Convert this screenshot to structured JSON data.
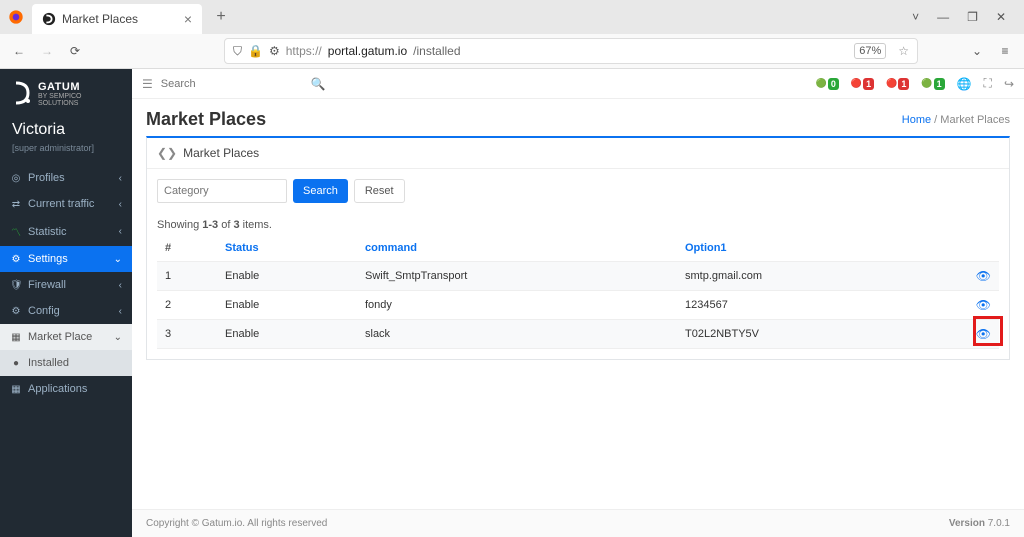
{
  "browser": {
    "tab_title": "Market Places",
    "url_proto": "https://",
    "url_domain": "portal.gatum.io",
    "url_path": "/installed",
    "zoom": "67%"
  },
  "brand": {
    "name": "GATUM",
    "sub": "BY SEMPICO SOLUTIONS"
  },
  "user": {
    "name": "Victoria",
    "role": "[super administrator]"
  },
  "nav": {
    "profiles": "Profiles",
    "current_traffic": "Current traffic",
    "statistic": "Statistic",
    "settings": "Settings",
    "firewall": "Firewall",
    "config": "Config",
    "market_place": "Market Place",
    "installed": "Installed",
    "applications": "Applications"
  },
  "topbar": {
    "search_placeholder": "Search"
  },
  "top_badges": [
    "0",
    "1",
    "1",
    "1"
  ],
  "page": {
    "title": "Market Places",
    "breadcrumb_home": "Home",
    "breadcrumb_current": "Market Places"
  },
  "panel": {
    "title": "Market Places",
    "category_placeholder": "Category",
    "search": "Search",
    "reset": "Reset"
  },
  "table": {
    "summary_prefix": "Showing ",
    "summary_range": "1-3",
    "summary_of": " of ",
    "summary_total": "3",
    "summary_suffix": " items.",
    "col_num": "#",
    "col_status": "Status",
    "col_command": "command",
    "col_option1": "Option1",
    "rows": [
      {
        "n": "1",
        "status": "Enable",
        "command": "Swift_SmtpTransport",
        "option1": "smtp.gmail.com"
      },
      {
        "n": "2",
        "status": "Enable",
        "command": "fondy",
        "option1": "1234567"
      },
      {
        "n": "3",
        "status": "Enable",
        "command": "slack",
        "option1": "T02L2NBTY5V"
      }
    ]
  },
  "footer": {
    "copyright": "Copyright © Gatum.io. All rights reserved",
    "version_label": "Version ",
    "version": "7.0.1"
  }
}
